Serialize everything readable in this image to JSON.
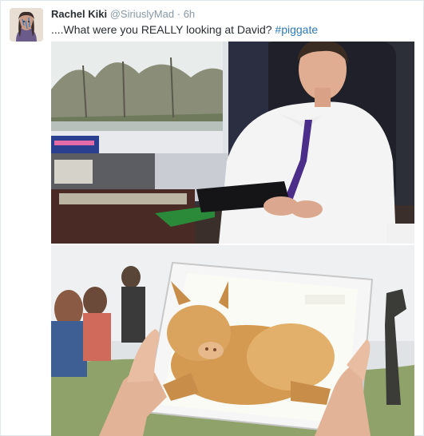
{
  "tweet": {
    "display_name": "Rachel Kiki",
    "handle": "@SiriuslyMad",
    "separator": "·",
    "timestamp": "6h",
    "text_main": "....What were you REALLY looking at David?",
    "hashtag": "#piggate"
  },
  "photos": [
    {
      "id": "photo-train"
    },
    {
      "id": "photo-pig-tablet"
    }
  ],
  "colors": {
    "link": "#2b7bb9",
    "muted": "#8899a6",
    "text": "#292f33"
  }
}
